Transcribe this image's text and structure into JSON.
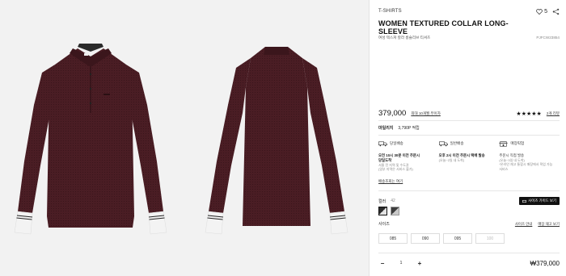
{
  "product": {
    "category": "T-SHIRTS",
    "wish_count": "5",
    "title": "WOMEN TEXTURED COLLAR LONG-SLEEVE",
    "subtitle": "여성 텍스쳐 칼라 롱슬리브 티셔츠",
    "code": "PJFCW23854",
    "price": "379,000",
    "benefit_link": "최대 10개월 무이자",
    "stars": "★★★★★",
    "review_link": "2개 리뷰",
    "mileage_label": "마일리지",
    "mileage_value": "3,790P 적립"
  },
  "delivery": [
    {
      "icon": "truck-icon",
      "label": "당일배송",
      "line1": "오전 10시 30분 이전 주문시",
      "line2": "당일도착",
      "note1": "서울 전 지역 및 수도권",
      "note2": "(일부 지역은 서비스 불가)"
    },
    {
      "icon": "truck-icon",
      "label": "일반배송",
      "line1": "오후 2시 이전 주문시 택배 발송",
      "line2": "",
      "note1": "(오늘~2일 내 도착)",
      "note2": ""
    },
    {
      "icon": "store-icon",
      "label": "매장픽업",
      "line1": "주문시 직접 발송",
      "line2": "",
      "note1": "(오늘~3일 내 도착)",
      "note2": "*온라인 재고 통합시 매장에서 픽업 가능 서비스"
    }
  ],
  "delivery_link": "배송조회는 여기",
  "color": {
    "label": "컬러",
    "count": "42",
    "size_guide_button": "사이즈 가이드 보기"
  },
  "size": {
    "label": "사이즈",
    "guide_link": "사이즈 안내",
    "stock_link": "매장 재고 보기",
    "options": [
      "085",
      "090",
      "095",
      "100"
    ]
  },
  "purchase": {
    "minus": "−",
    "qty": "1",
    "plus": "+",
    "total": "₩379,000"
  }
}
